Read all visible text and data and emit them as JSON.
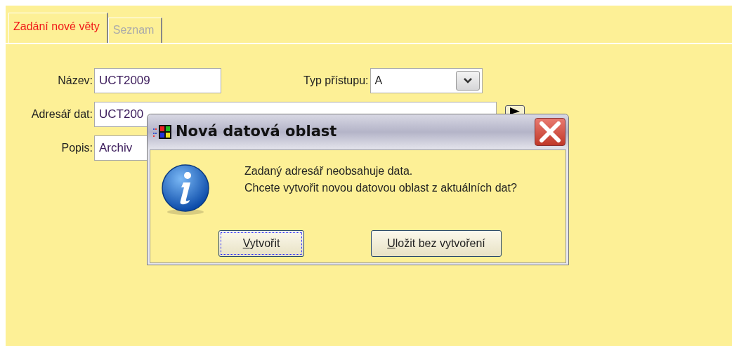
{
  "tabs": [
    {
      "label": "Zadání nové věty",
      "selected": true
    },
    {
      "label": "Seznam",
      "selected": false
    }
  ],
  "form": {
    "name": {
      "label": "Název:",
      "value": "UCT2009"
    },
    "access_type": {
      "label": "Typ přístupu:",
      "value": "A"
    },
    "data_dir": {
      "label": "Adresář dat:",
      "value": "UCT200"
    },
    "description": {
      "label": "Popis:",
      "value": "Archiv"
    }
  },
  "dialog": {
    "title": "Nová datová oblast",
    "message": [
      "Zadaný adresář neobsahuje data.",
      "Chcete vytvořit novou datovou oblast z aktuálních dat?"
    ],
    "buttons": [
      {
        "label": "Vytvořit",
        "focused": true
      },
      {
        "label": "Uložit bez vytvoření",
        "focused": false
      }
    ]
  }
}
